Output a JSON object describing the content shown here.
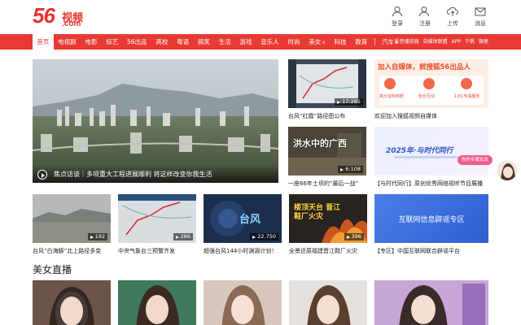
{
  "header": {
    "logo_number": "56",
    "logo_cn": "视频",
    "logo_domain": ".com",
    "tools": [
      {
        "label": "登录",
        "icon": "user-icon"
      },
      {
        "label": "注册",
        "icon": "user-add-icon"
      },
      {
        "label": "上传",
        "icon": "upload-icon"
      },
      {
        "label": "消息",
        "icon": "mail-icon"
      }
    ]
  },
  "nav": {
    "items": [
      {
        "label": "首页",
        "active": true
      },
      {
        "label": "电视剧"
      },
      {
        "label": "电影"
      },
      {
        "label": "综艺"
      },
      {
        "label": "56出品"
      },
      {
        "label": "高校"
      },
      {
        "label": "粤语"
      },
      {
        "label": "搞笑"
      },
      {
        "label": "生活"
      },
      {
        "label": "游戏"
      },
      {
        "label": "音乐人"
      },
      {
        "label": "时尚"
      },
      {
        "label": "美女",
        "chevron": "∨"
      },
      {
        "label": "科技"
      },
      {
        "label": "教育"
      },
      {
        "label": "汽车",
        "chevron": "∨"
      }
    ],
    "right": [
      "影音播放器",
      "自媒体联盟",
      "APP",
      "千帆",
      "微更"
    ]
  },
  "hero": {
    "caption": "焦点访谈｜多项重大工程进展顺利 将这样改变你我生活"
  },
  "cards_row1": [
    {
      "caption": "台风“红霞”路径图公布",
      "duration": "17:285"
    },
    {
      "caption": "欢迎加入搜狐视频自媒体",
      "banner_title": "加入自媒体，就搜狐56出品人",
      "banner_items": [
        "高分成秒到账",
        "粉丝互动",
        "1对1专属服务"
      ]
    }
  ],
  "cards_row2": [
    {
      "caption": "一座66年土坝的“最后一战”",
      "overlay": "洪水中的广西",
      "duration": "6:108"
    },
    {
      "caption": "【与时代同行】原创优秀网络视听节目展播",
      "overlay": "2025年·与时代同行"
    }
  ],
  "cards_row3": [
    {
      "caption": "台风“白海豚”北上路径多变",
      "duration": "192"
    },
    {
      "caption": "中央气象台三预警齐发",
      "duration": "286"
    },
    {
      "caption": "超强台风144小时渊源计划！",
      "overlay": "台风",
      "duration": "22.750"
    },
    {
      "caption": "全景还原福建晋江鞋厂火灾",
      "overlay": "楼顶天台 晋江鞋厂火灾",
      "duration": "396"
    },
    {
      "caption": "【专区】中国互联网联合辟谣平台",
      "overlay": "互联网信息辟谣专区"
    }
  ],
  "section": {
    "title": "美女直播"
  },
  "float": {
    "label": "你的专属女友"
  },
  "colors": {
    "brand": "#e83a33",
    "logo": "#e5322f"
  }
}
